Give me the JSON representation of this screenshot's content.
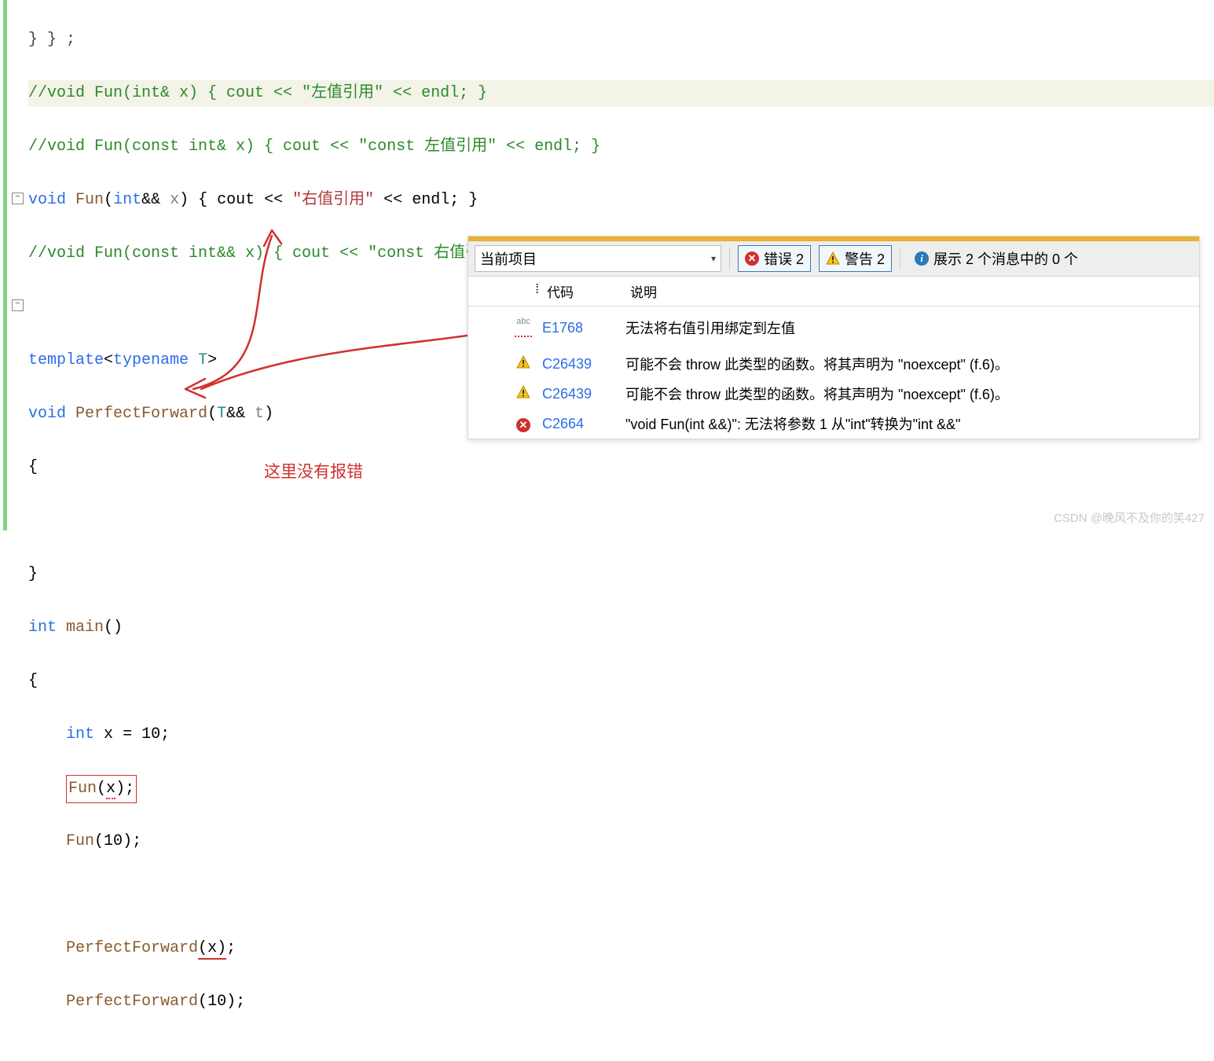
{
  "code": {
    "l1": "//void Fun(int& x) { cout << \"左值引用\" << endl; }",
    "l2": "//void Fun(const int& x) { cout << \"const 左值引用\" << endl; }",
    "l3a": "void",
    "l3b": "Fun",
    "l3c": "int",
    "l3d": "x",
    "l3e": "cout",
    "l3f": "\"右值引用\"",
    "l3g": "endl",
    "l4": "//void Fun(const int&& x) { cout << \"const 右值引用\" << endl; }",
    "l6a": "template",
    "l6b": "typename",
    "l6c": "T",
    "l7a": "void",
    "l7b": "PerfectForward",
    "l7c": "T",
    "l7d": "t",
    "l8": "{",
    "l10": "}",
    "l11a": "int",
    "l11b": "main",
    "l12": "{",
    "l13a": "int",
    "l13b": "x",
    "l13c": "10",
    "l14a": "Fun",
    "l14b": "x",
    "l15a": "Fun",
    "l15b": "10",
    "l17a": "PerfectForward",
    "l17b": "x",
    "l18a": "PerfectForward",
    "l18b": "10"
  },
  "annot": "这里没有报错",
  "panel": {
    "dropdown": "当前项目",
    "errors": "错误 2",
    "warnings": "警告 2",
    "messages": "展示 2 个消息中的 0 个",
    "head_code": "代码",
    "head_desc": "说明",
    "rows": [
      {
        "icon": "abc",
        "code": "E1768",
        "desc": "无法将右值引用绑定到左值"
      },
      {
        "icon": "warn",
        "code": "C26439",
        "desc": "可能不会 throw 此类型的函数。将其声明为 \"noexcept\" (f.6)。"
      },
      {
        "icon": "warn",
        "code": "C26439",
        "desc": "可能不会 throw 此类型的函数。将其声明为 \"noexcept\" (f.6)。"
      },
      {
        "icon": "err",
        "code": "C2664",
        "desc": "\"void Fun(int &&)\": 无法将参数 1 从\"int\"转换为\"int &&\""
      }
    ]
  },
  "watermark": "CSDN @晚风不及你的笑427"
}
